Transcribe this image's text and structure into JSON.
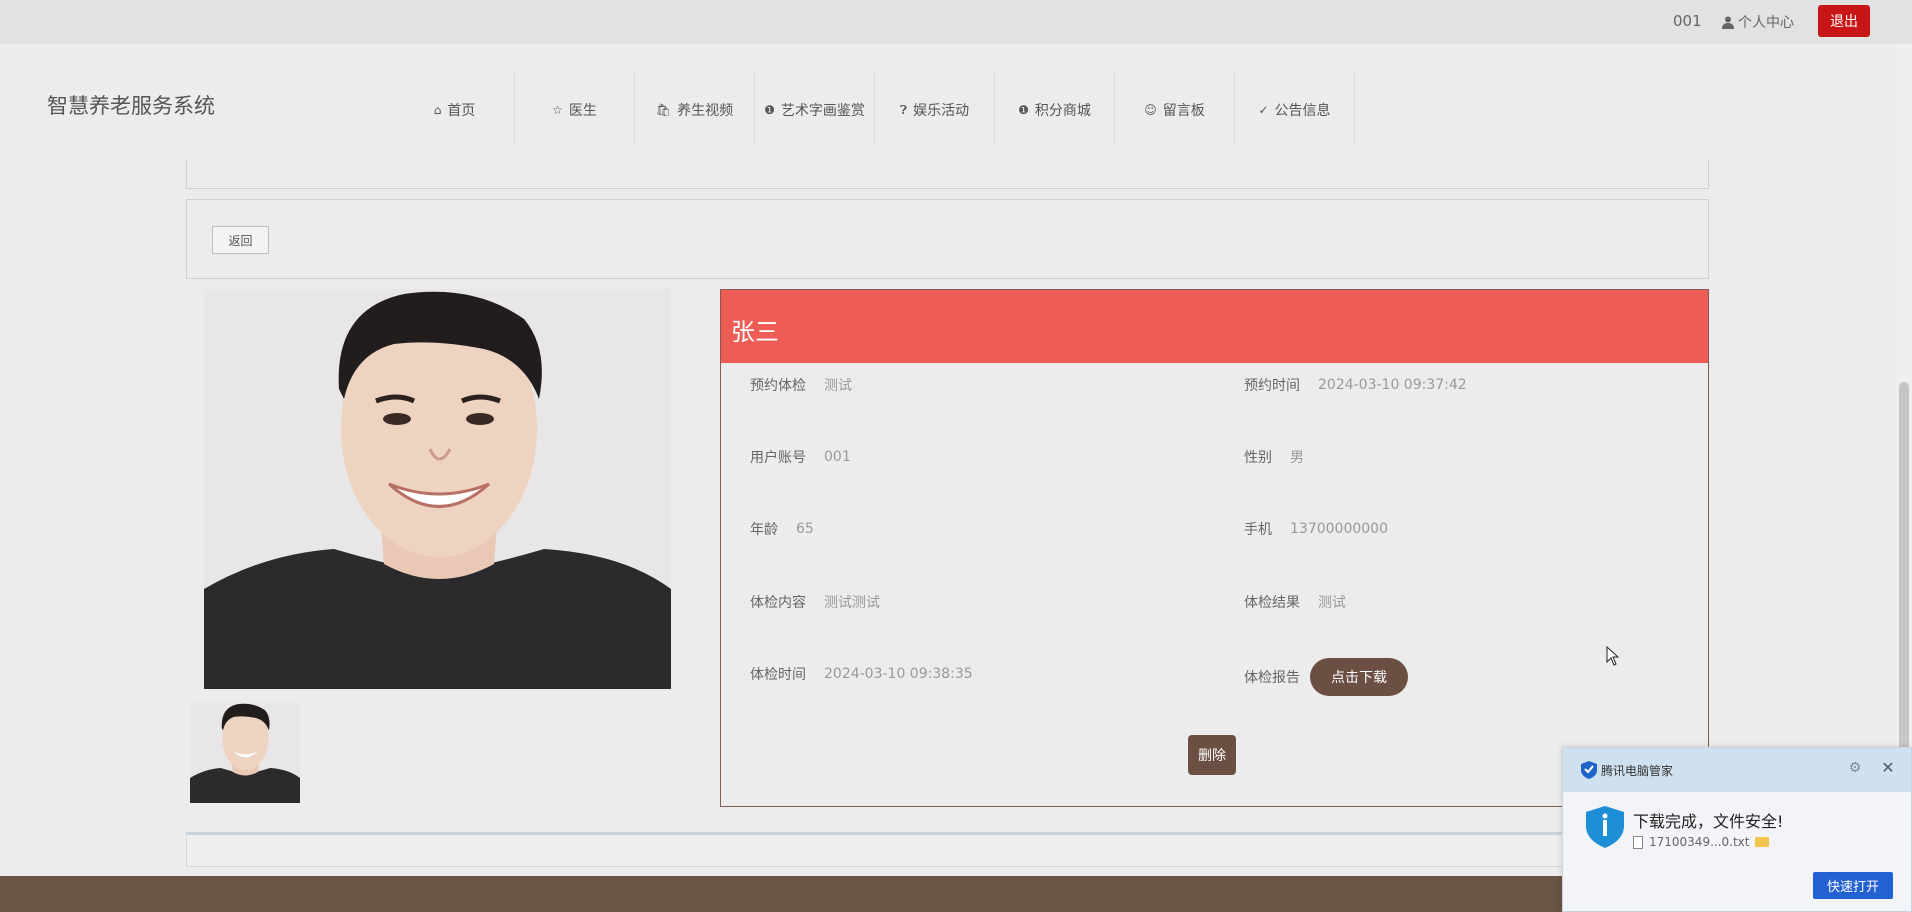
{
  "topbar": {
    "account": "001",
    "user_center": "个人中心",
    "logout": "退出"
  },
  "header": {
    "brand": "智慧养老服务系统",
    "nav": [
      {
        "label": "首页",
        "icon": "home-icon"
      },
      {
        "label": "医生",
        "icon": "star-icon"
      },
      {
        "label": "养生视频",
        "icon": "bag-icon"
      },
      {
        "label": "艺术字画鉴赏",
        "icon": "info-icon"
      },
      {
        "label": "娱乐活动",
        "icon": "question-icon"
      },
      {
        "label": "积分商城",
        "icon": "info-icon"
      },
      {
        "label": "留言板",
        "icon": "smile-icon"
      },
      {
        "label": "公告信息",
        "icon": "check-circle-icon"
      }
    ]
  },
  "back_label": "返回",
  "detail": {
    "name": "张三",
    "fields": {
      "appointment_exam": {
        "label": "预约体检",
        "value": "测试"
      },
      "appointment_time": {
        "label": "预约时间",
        "value": "2024-03-10 09:37:42"
      },
      "user_account": {
        "label": "用户账号",
        "value": "001"
      },
      "gender": {
        "label": "性别",
        "value": "男"
      },
      "age": {
        "label": "年龄",
        "value": "65"
      },
      "phone": {
        "label": "手机",
        "value": "13700000000"
      },
      "exam_content": {
        "label": "体检内容",
        "value": "测试测试"
      },
      "exam_result": {
        "label": "体检结果",
        "value": "测试"
      },
      "exam_time": {
        "label": "体检时间",
        "value": "2024-03-10 09:38:35"
      },
      "exam_report": {
        "label": "体检报告"
      }
    },
    "download_label": "点击下载",
    "delete_label": "删除"
  },
  "popup": {
    "title": "腾讯电脑管家",
    "message": "下载完成，文件安全!",
    "file_name": "17100349...0.txt",
    "open_label": "快速打开"
  },
  "colors": {
    "header_red": "#ee5d55",
    "brown_button": "#6b4f43",
    "logout_red": "#c81515",
    "footer": "#6b5445",
    "popup_blue": "#2361d3"
  }
}
